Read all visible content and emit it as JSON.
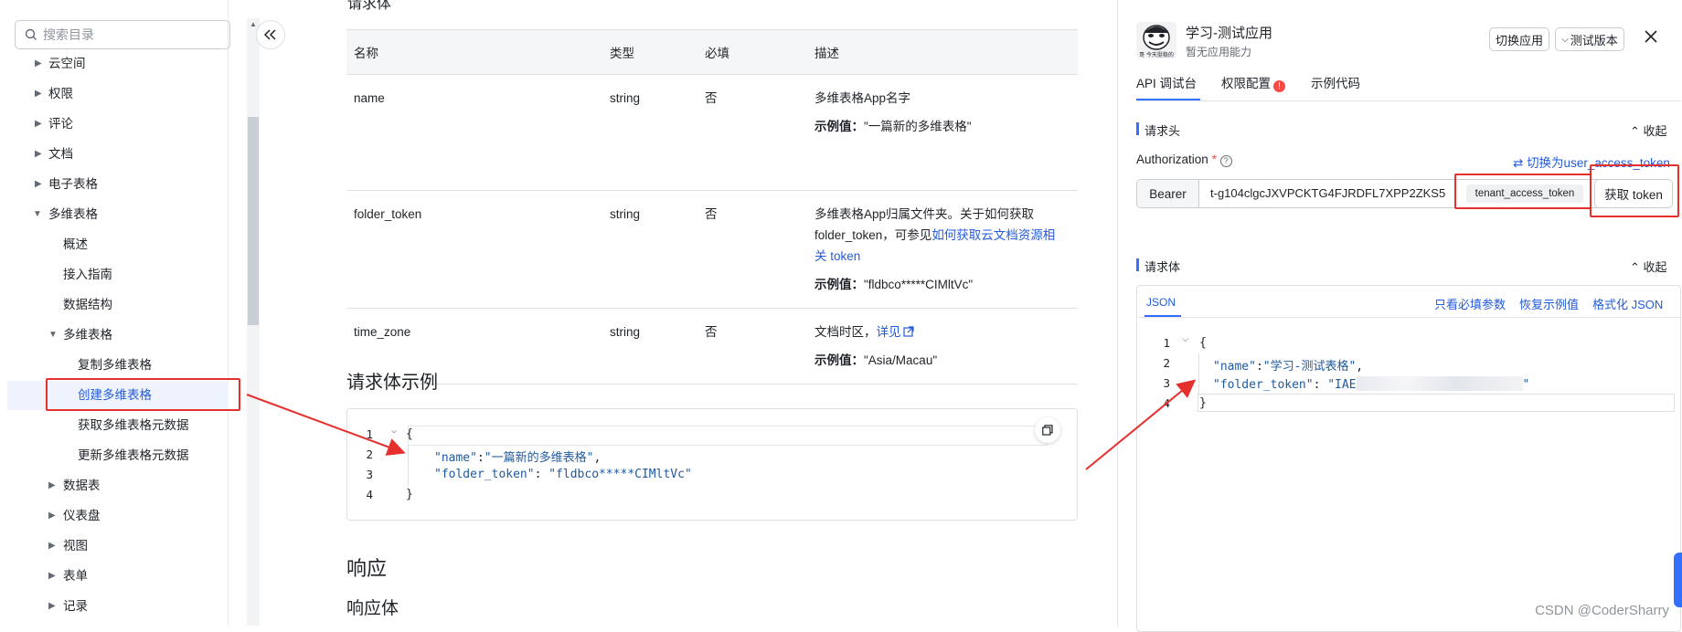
{
  "sidebar": {
    "search_placeholder": "搜索目录",
    "items": [
      {
        "label": "云空间"
      },
      {
        "label": "权限"
      },
      {
        "label": "评论"
      },
      {
        "label": "文档"
      },
      {
        "label": "电子表格"
      },
      {
        "label": "多维表格"
      },
      {
        "label": "概述"
      },
      {
        "label": "接入指南"
      },
      {
        "label": "数据结构"
      },
      {
        "label": "多维表格"
      },
      {
        "label": "复制多维表格"
      },
      {
        "label": "创建多维表格"
      },
      {
        "label": "获取多维表格元数据"
      },
      {
        "label": "更新多维表格元数据"
      },
      {
        "label": "数据表"
      },
      {
        "label": "仪表盘"
      },
      {
        "label": "视图"
      },
      {
        "label": "表单"
      },
      {
        "label": "记录"
      }
    ]
  },
  "main": {
    "top_partial": "请求体",
    "table": {
      "headers": [
        "名称",
        "类型",
        "必填",
        "描述"
      ],
      "rows": [
        {
          "name": "name",
          "type": "string",
          "required": "否",
          "desc": "多维表格App名字",
          "example_label": "示例值：",
          "example": "\"一篇新的多维表格\""
        },
        {
          "name": "folder_token",
          "type": "string",
          "required": "否",
          "desc1": "多维表格App归属文件夹。关于如何获取",
          "desc2_a": "folder_token，可参见",
          "desc2_link": "如何获取云文档资源相",
          "desc3_link": "关 token",
          "example_label": "示例值：",
          "example": "\"fldbco*****CIMltVc\""
        },
        {
          "name": "time_zone",
          "type": "string",
          "required": "否",
          "desc": "文档时区，",
          "desc_link": "详见",
          "example_label": "示例值：",
          "example": "\"Asia/Macau\""
        }
      ]
    },
    "request_example_title": "请求体示例",
    "code": {
      "lines": [
        "1",
        "2",
        "3",
        "4"
      ],
      "l1": "{",
      "l2_key": "\"name\"",
      "l2_val": "\"一篇新的多维表格\"",
      "l3_key": "\"folder_token\"",
      "l3_val": "\"fldbco*****CIMltVc\"",
      "l4": "}"
    },
    "response_title": "响应",
    "response_body_title": "响应体"
  },
  "panel": {
    "app_name": "学习-测试应用",
    "app_sub": "暂无应用能力",
    "avatar_caption": "哥 今天挺稳的",
    "switch_app": "切换应用",
    "test_version": "测试版本",
    "tabs": [
      "API 调试台",
      "权限配置",
      "示例代码"
    ],
    "request_header": "请求头",
    "collapse": "收起",
    "auth_label": "Authorization",
    "switch_user_token": "切换为user_access_token",
    "bearer": "Bearer",
    "token_value": "t-g104clgcJXVPCKTG4FJRDFL7XPP2ZKS5",
    "token_type": "tenant_access_token",
    "get_token": "获取 token",
    "request_body": "请求体",
    "json_tab": "JSON",
    "only_required": "只看必填参数",
    "restore_example": "恢复示例值",
    "format_json": "格式化 JSON",
    "code": {
      "lines": [
        "1",
        "2",
        "3",
        "4"
      ],
      "l1": "{",
      "l2_key": "\"name\"",
      "l2_val": "\"学习-测试表格\"",
      "l3_key": "\"folder_token\"",
      "l3_val_prefix": "\"IAE",
      "l3_val_suffix": "\"",
      "l4": "}"
    }
  },
  "watermark": "CSDN @CoderSharry",
  "colors": {
    "accent": "#3370ff",
    "link": "#245bdb",
    "annotation_red": "#e5302e"
  }
}
